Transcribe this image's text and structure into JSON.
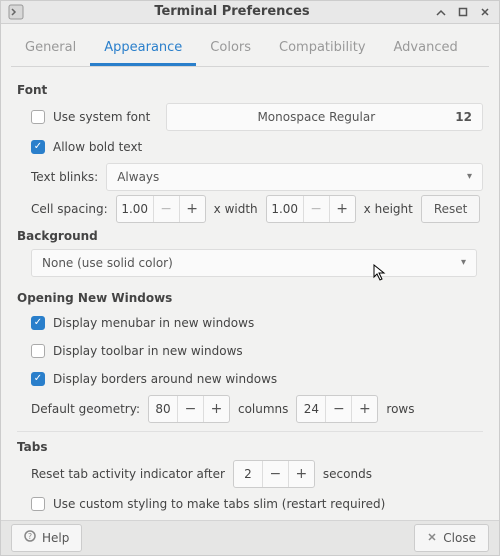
{
  "window": {
    "title": "Terminal Preferences"
  },
  "tabs": [
    "General",
    "Appearance",
    "Colors",
    "Compatibility",
    "Advanced"
  ],
  "active_tab_index": 1,
  "font": {
    "section": "Font",
    "use_system_label": "Use system font",
    "font_name": "Monospace Regular",
    "font_size": "12",
    "allow_bold_label": "Allow bold text",
    "blinks_label": "Text blinks:",
    "blinks_value": "Always",
    "cell_spacing_label": "Cell spacing:",
    "cell_w": "1.00",
    "x_width": "x width",
    "cell_h": "1.00",
    "x_height": "x height",
    "reset": "Reset"
  },
  "background": {
    "section": "Background",
    "value": "None (use solid color)"
  },
  "opening": {
    "section": "Opening New Windows",
    "menubar_label": "Display menubar in new windows",
    "toolbar_label": "Display toolbar in new windows",
    "borders_label": "Display borders around new windows",
    "geometry_label": "Default geometry:",
    "cols_value": "80",
    "cols_label": "columns",
    "rows_value": "24",
    "rows_label": "rows"
  },
  "tabs_section": {
    "section": "Tabs",
    "reset_label_pre": "Reset tab activity indicator after",
    "reset_value": "2",
    "reset_label_post": "seconds",
    "slim_label": "Use custom styling to make tabs slim (restart required)"
  },
  "footer": {
    "help": "Help",
    "close": "Close"
  }
}
